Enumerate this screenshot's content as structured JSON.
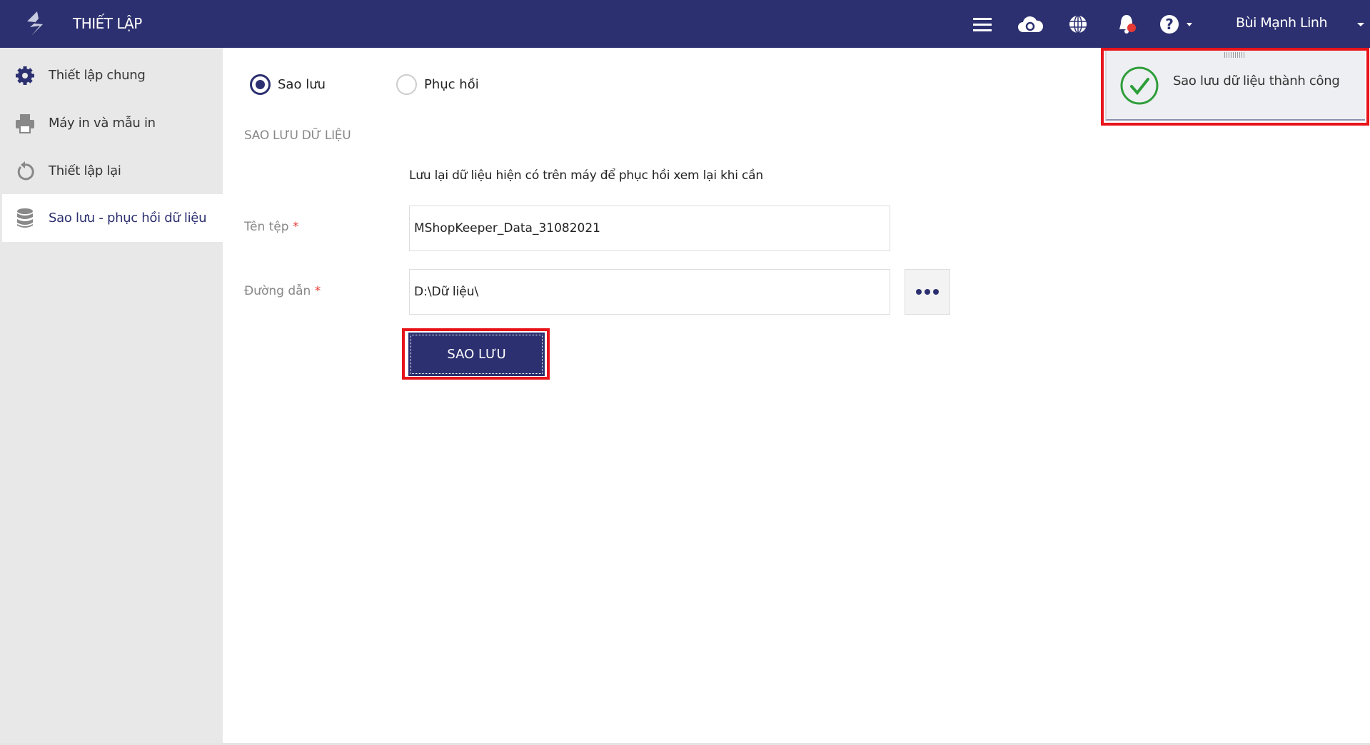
{
  "header": {
    "title": "THIẾT LẬP",
    "user_name": "Bùi Mạnh Linh",
    "icons": [
      "menu-icon",
      "cloud-sync-icon",
      "globe-icon",
      "bell-icon",
      "help-icon"
    ]
  },
  "sidebar": {
    "items": [
      {
        "label": "Thiết lập chung",
        "icon": "gear-icon"
      },
      {
        "label": "Máy in và mẫu in",
        "icon": "printer-icon"
      },
      {
        "label": "Thiết lập lại",
        "icon": "reset-icon"
      },
      {
        "label": "Sao lưu - phục hồi dữ liệu",
        "icon": "database-icon",
        "active": true
      }
    ]
  },
  "main": {
    "radios": [
      {
        "label": "Sao lưu",
        "checked": true
      },
      {
        "label": "Phục hồi",
        "checked": false
      }
    ],
    "section_title": "SAO LƯU DỮ LIỆU",
    "description": "Lưu lại dữ liệu hiện có trên máy để phục hồi xem lại khi cần",
    "file_name": {
      "label": "Tên tệp",
      "required": "*",
      "value": "MShopKeeper_Data_31082021"
    },
    "path": {
      "label": "Đường dẫn",
      "required": "*",
      "value": "D:\\Dữ liệu\\"
    },
    "backup_button": "SAO LƯU"
  },
  "toast": {
    "message": "Sao lưu dữ liệu thành công",
    "icon": "check-circle-icon"
  },
  "colors": {
    "primary": "#2c3070",
    "highlight": "#e8141b",
    "success": "#2e9e3a",
    "notify": "#e53935"
  }
}
